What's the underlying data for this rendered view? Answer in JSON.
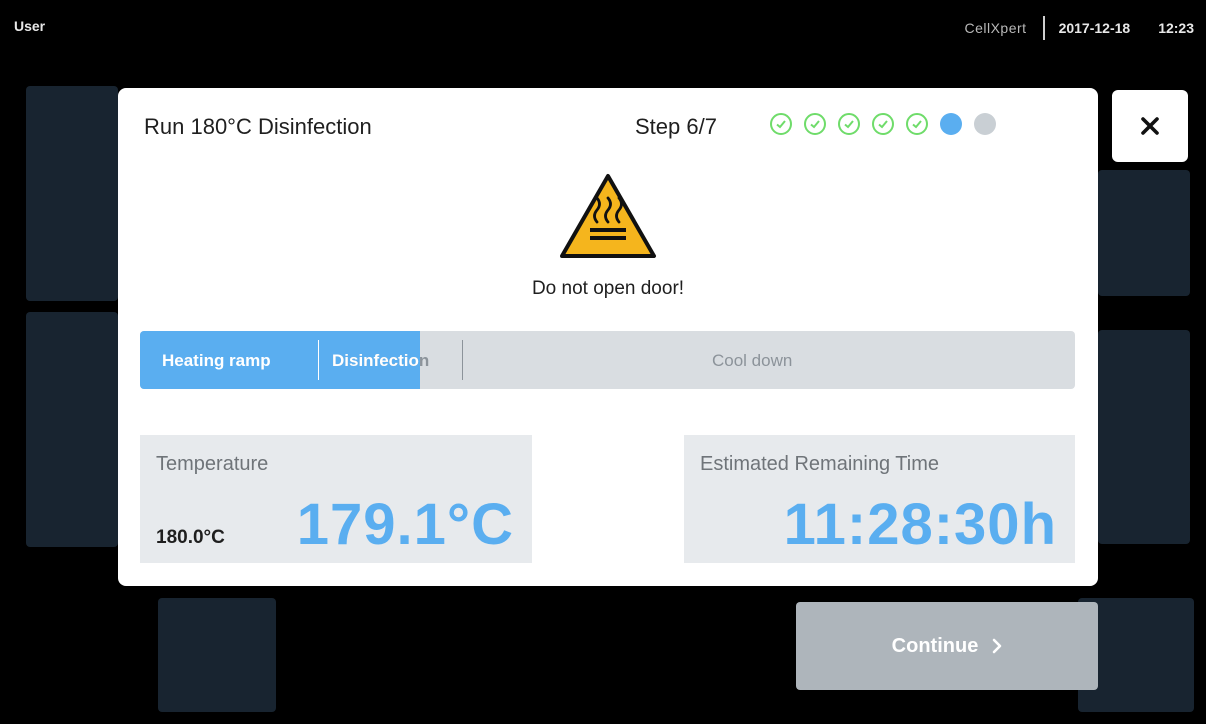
{
  "status": {
    "user": "User",
    "brand": "CellXpert",
    "date": "2017-12-18",
    "time": "12:23"
  },
  "dialog": {
    "title": "Run 180°C Disinfection",
    "step_label": "Step 6/7",
    "steps": [
      "done",
      "done",
      "done",
      "done",
      "done",
      "current",
      "todo"
    ],
    "close_symbol": "✕",
    "warning_icon": "hot-surface-warning-icon",
    "warning_text": "Do not open door!",
    "phases": {
      "heating": "Heating ramp",
      "disinfection": "Disinfection",
      "cooldown": "Cool down"
    },
    "temperature": {
      "label": "Temperature",
      "setpoint": "180.0°C",
      "value": "179.1°C"
    },
    "remaining": {
      "label": "Estimated Remaining Time",
      "value": "11:28:30h"
    }
  },
  "continue_label": "Continue",
  "colors": {
    "accent_blue": "#5aaef0",
    "done_green": "#6fdc6a",
    "pending_grey": "#c9cfd4",
    "warning_yellow": "#f5b51d"
  }
}
